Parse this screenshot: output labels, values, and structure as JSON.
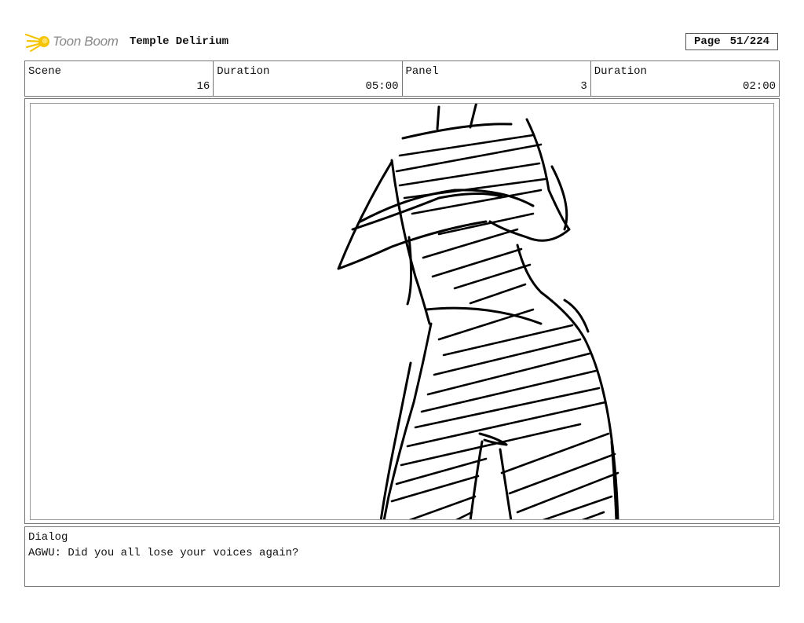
{
  "header": {
    "brand": "Toon Boom",
    "project_title": "Temple Delirium",
    "page_label": "Page",
    "page_value": "51/224"
  },
  "info": {
    "scene_label": "Scene",
    "scene_value": "16",
    "scene_duration_label": "Duration",
    "scene_duration_value": "05:00",
    "panel_label": "Panel",
    "panel_value": "3",
    "panel_duration_label": "Duration",
    "panel_duration_value": "02:00"
  },
  "panel": {
    "sketch_icon": "figure-sketch",
    "line_color": "#000000"
  },
  "dialog": {
    "label": "Dialog",
    "text": "AGWU: Did you all lose your voices again?"
  },
  "colors": {
    "logo_flame": "#f5c400",
    "logo_text": "#8a8a8a",
    "border": "#777777"
  }
}
